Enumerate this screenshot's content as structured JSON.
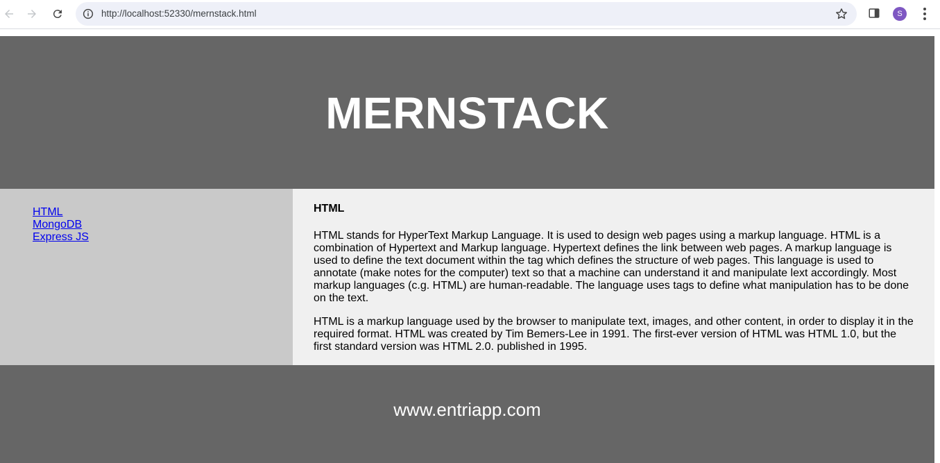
{
  "browser": {
    "url": "http://localhost:52330/mernstack.html",
    "avatar_letter": "S",
    "icons": [
      "back-arrow-icon",
      "forward-arrow-icon",
      "reload-icon",
      "info-icon",
      "star-icon",
      "side-panel-icon",
      "kebab-menu-icon"
    ]
  },
  "header": {
    "title": "MERNSTACK"
  },
  "sidebar": {
    "links": [
      {
        "label": "HTML"
      },
      {
        "label": "MongoDB"
      },
      {
        "label": "Express JS"
      }
    ]
  },
  "article": {
    "heading": "HTML",
    "paragraphs": [
      "HTML stands for HyperText Markup Language. It is used to design web pages using a markup language. HTML is a combination of Hypertext and Markup language. Hypertext defines the link between web pages. A markup language is used to define the text document within the tag which defines the structure of web pages. This language is used to annotate (make notes for the computer) text so that a machine can understand it and manipulate lext accordingly. Most markup languages (c.g. HTML) are human-readable. The language uses tags to define what manipulation has to be done on the text.",
      "HTML is a markup language used by the browser to manipulate text, images, and other content, in order to display it in the required format. HTML was created by Tim Bemers-Lee in 1991. The first-ever version of HTML was HTML 1.0, but the first standard version was HTML 2.0. published in 1995."
    ]
  },
  "footer": {
    "text": "www.entriapp.com"
  },
  "colors": {
    "header_bg": "#666666",
    "sidebar_bg": "#c9c9c9",
    "article_bg": "#f0f0f0",
    "link": "#0000ee",
    "avatar": "#7e57c2"
  }
}
